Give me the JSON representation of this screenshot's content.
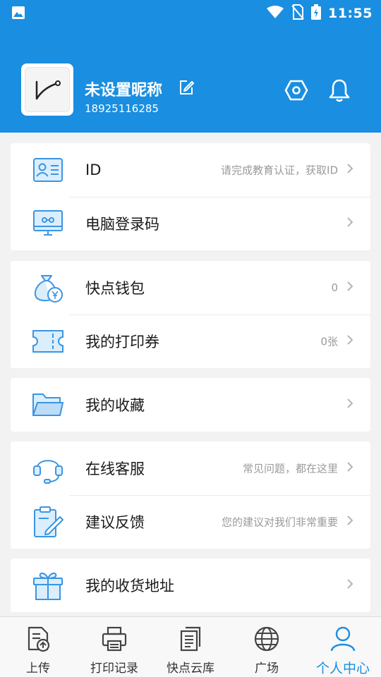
{
  "status_bar": {
    "time": "11:55"
  },
  "profile": {
    "nickname": "未设置昵称",
    "phone": "18925116285"
  },
  "groups": [
    {
      "items": [
        {
          "label": "ID",
          "hint": "请完成教育认证，获取ID",
          "icon": "id-card-icon"
        },
        {
          "label": "电脑登录码",
          "hint": "",
          "icon": "monitor-icon"
        }
      ]
    },
    {
      "items": [
        {
          "label": "快点钱包",
          "hint": "0",
          "icon": "money-bag-icon"
        },
        {
          "label": "我的打印券",
          "hint": "0张",
          "icon": "ticket-icon"
        }
      ]
    },
    {
      "items": [
        {
          "label": "我的收藏",
          "hint": "",
          "icon": "folder-icon"
        }
      ]
    },
    {
      "items": [
        {
          "label": "在线客服",
          "hint": "常见问题，都在这里",
          "icon": "headset-icon"
        },
        {
          "label": "建议反馈",
          "hint": "您的建议对我们非常重要",
          "icon": "clipboard-pen-icon"
        }
      ]
    },
    {
      "items": [
        {
          "label": "我的收货地址",
          "hint": "",
          "icon": "gift-box-icon"
        }
      ]
    }
  ],
  "tabs": [
    {
      "label": "上传",
      "icon": "upload-doc-icon",
      "active": false
    },
    {
      "label": "打印记录",
      "icon": "printer-icon",
      "active": false
    },
    {
      "label": "快点云库",
      "icon": "document-stack-icon",
      "active": false
    },
    {
      "label": "广场",
      "icon": "globe-icon",
      "active": false
    },
    {
      "label": "个人中心",
      "icon": "person-icon",
      "active": true
    }
  ],
  "colors": {
    "brand": "#1a8ee0",
    "icon_fill": "#dbeefd",
    "hint_text": "#9a9a9a"
  }
}
